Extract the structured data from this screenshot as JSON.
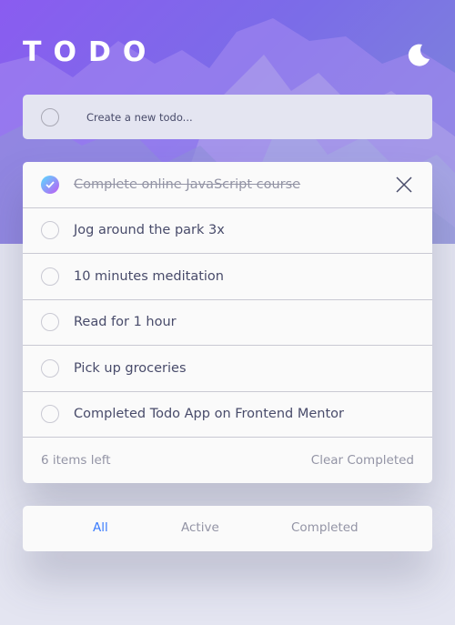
{
  "header": {
    "title": "TODO",
    "theme_icon": "moon-icon"
  },
  "new_todo": {
    "placeholder": "Create a new todo..."
  },
  "todos": [
    {
      "text": "Complete online JavaScript course",
      "completed": true
    },
    {
      "text": "Jog around the park 3x",
      "completed": false
    },
    {
      "text": "10 minutes meditation",
      "completed": false
    },
    {
      "text": "Read for 1 hour",
      "completed": false
    },
    {
      "text": "Pick up groceries",
      "completed": false
    },
    {
      "text": "Completed Todo App on Frontend Mentor",
      "completed": false
    }
  ],
  "footer": {
    "items_left": "6 items left",
    "clear_completed": "Clear Completed"
  },
  "filters": {
    "all": "All",
    "active": "Active",
    "completed": "Completed",
    "selected": "All"
  },
  "colors": {
    "accent": "#3a7bfd",
    "check_gradient_start": "#57ddff",
    "check_gradient_end": "#c058f3",
    "text": "#484b6a",
    "muted": "#9394a5",
    "background": "#e4e5f1"
  }
}
